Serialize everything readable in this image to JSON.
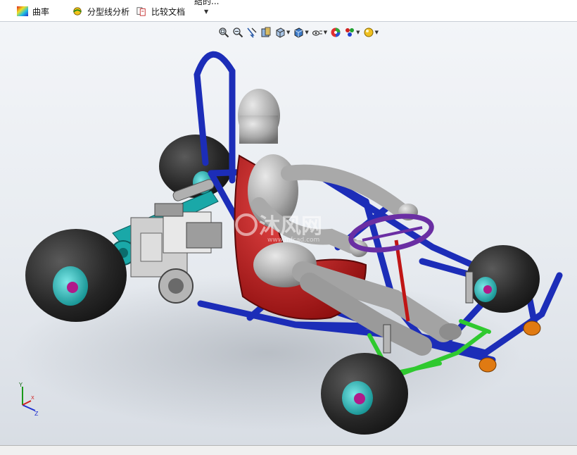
{
  "ribbon": {
    "items": [
      {
        "label": "曲率",
        "icon": "curvature-icon"
      },
      {
        "label": "分型线分析",
        "icon": "parting-line-analysis-icon"
      },
      {
        "label": "比较文档",
        "icon": "compare-documents-icon"
      }
    ],
    "cutoff_label": "結的..."
  },
  "headsup_toolbar": {
    "buttons": [
      {
        "name": "zoom-to-fit-icon"
      },
      {
        "name": "zoom-to-area-icon"
      },
      {
        "name": "previous-view-icon"
      },
      {
        "name": "section-view-icon"
      },
      {
        "name": "view-orientation-icon"
      },
      {
        "name": "display-style-icon"
      },
      {
        "name": "hide-show-items-icon"
      },
      {
        "name": "edit-appearance-icon"
      },
      {
        "name": "apply-scene-icon"
      },
      {
        "name": "view-settings-icon"
      }
    ]
  },
  "model": {
    "description": "go-kart assembly with driver mannequin",
    "colors": {
      "frame": "#1c2db8",
      "seat": "#c01515",
      "steering_wheel": "#6a2ea3",
      "tires": "#1d1d1d",
      "hubs": "#13a9a9",
      "suspension": "#2fc92f",
      "mannequin": "#a9a9a9",
      "bumper_light": "#e07a12"
    }
  },
  "watermark": {
    "text": "沐风网",
    "subtext": "www.mfcad.com"
  },
  "triad": {
    "x": "X",
    "y": "Y",
    "z": "Z"
  }
}
